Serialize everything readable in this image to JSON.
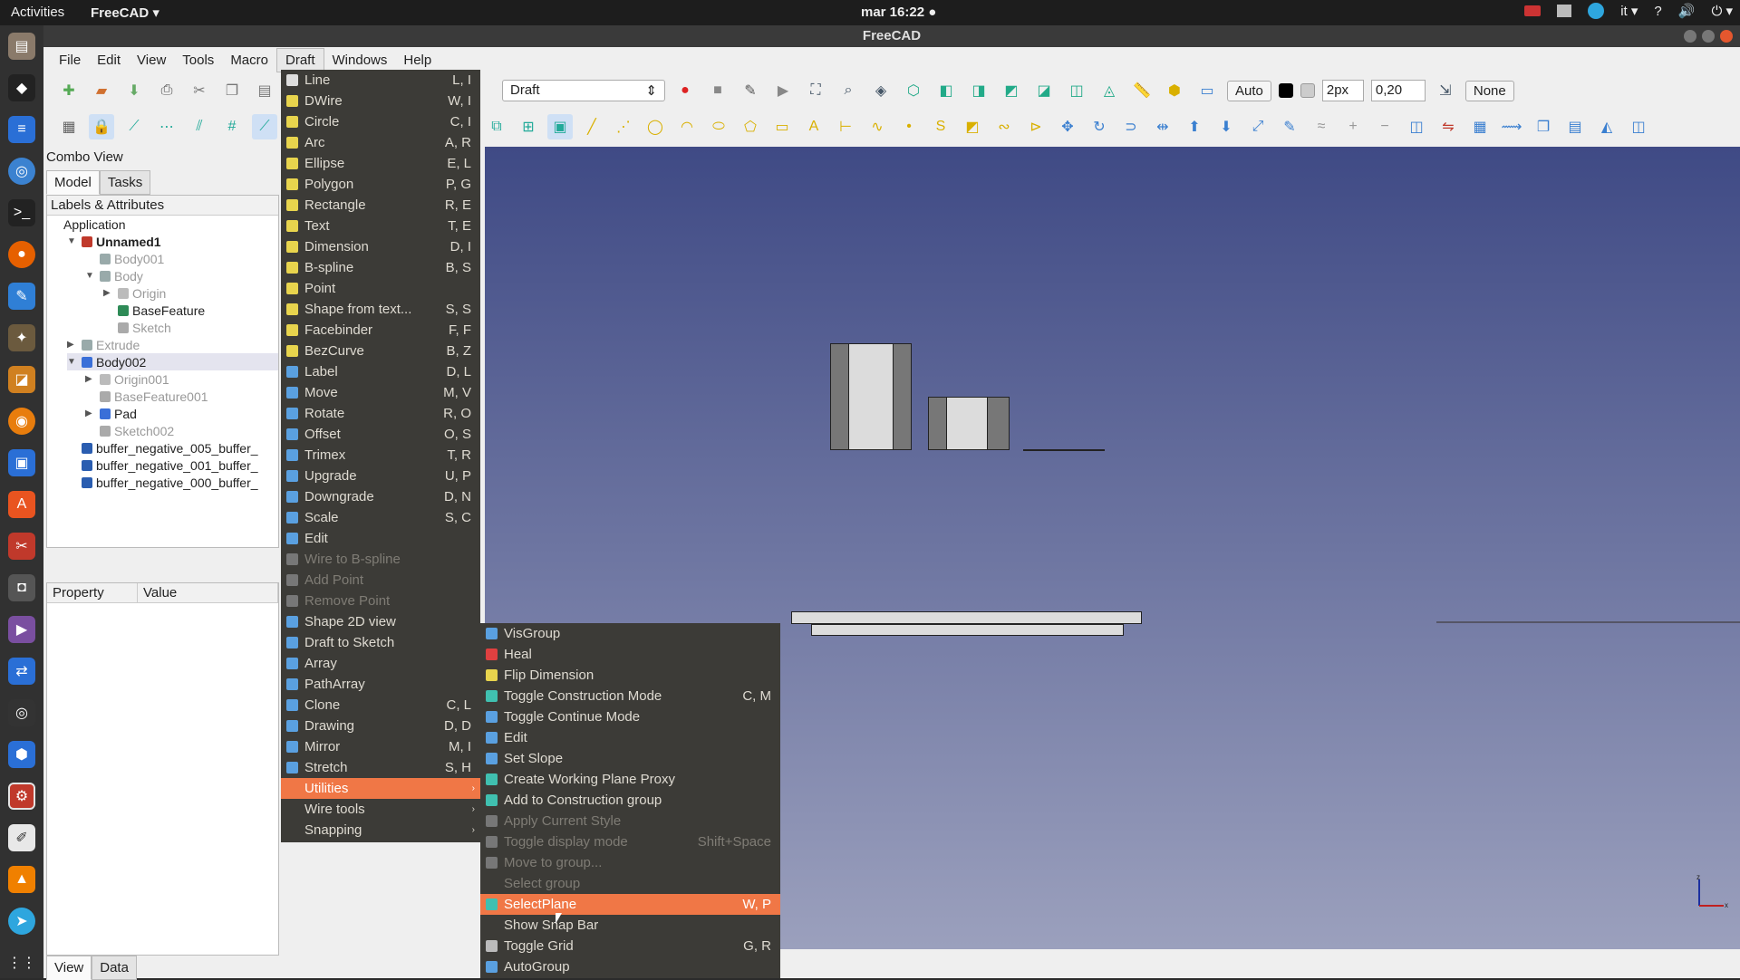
{
  "topbar": {
    "activities": "Activities",
    "app": "FreeCAD ▾",
    "clock": "mar 16:22 ●",
    "lang": "it ▾",
    "help": "?",
    "vol": "🔊",
    "power": "⏻ ▾"
  },
  "window": {
    "title": "FreeCAD"
  },
  "menubar": [
    "File",
    "Edit",
    "View",
    "Tools",
    "Macro",
    "Draft",
    "Windows",
    "Help"
  ],
  "toolbar": {
    "workbench": "Draft",
    "auto": "Auto",
    "linewidth": "2px",
    "fontsize": "0,20",
    "none": "None"
  },
  "combo": {
    "title": "Combo View",
    "tabs": [
      "Model",
      "Tasks"
    ],
    "tree_header": "Labels & Attributes",
    "bottom_tabs": [
      "View",
      "Data"
    ],
    "prop_headers": [
      "Property",
      "Value"
    ]
  },
  "tree": [
    {
      "label": "Application",
      "indent": 0,
      "style": "normal",
      "arrow": "",
      "icon": ""
    },
    {
      "label": "Unnamed1",
      "indent": 1,
      "style": "bold",
      "arrow": "▼",
      "icon": "#c0392b"
    },
    {
      "label": "Body001",
      "indent": 2,
      "style": "dim",
      "arrow": "",
      "icon": "#9aa"
    },
    {
      "label": "Body",
      "indent": 2,
      "style": "dim",
      "arrow": "▼",
      "icon": "#9aa"
    },
    {
      "label": "Origin",
      "indent": 3,
      "style": "dim",
      "arrow": "▶",
      "icon": "#bbb"
    },
    {
      "label": "BaseFeature",
      "indent": 3,
      "style": "normal",
      "arrow": "",
      "icon": "#2e8b57"
    },
    {
      "label": "Sketch",
      "indent": 3,
      "style": "dim",
      "arrow": "",
      "icon": "#aaa"
    },
    {
      "label": "Extrude",
      "indent": 1,
      "style": "dim",
      "arrow": "▶",
      "icon": "#9aa"
    },
    {
      "label": "Body002",
      "indent": 1,
      "style": "sel",
      "arrow": "▼",
      "icon": "#3a6fd8"
    },
    {
      "label": "Origin001",
      "indent": 2,
      "style": "dim",
      "arrow": "▶",
      "icon": "#bbb"
    },
    {
      "label": "BaseFeature001",
      "indent": 2,
      "style": "dim",
      "arrow": "",
      "icon": "#aaa"
    },
    {
      "label": "Pad",
      "indent": 2,
      "style": "normal",
      "arrow": "▶",
      "icon": "#3a6fd8"
    },
    {
      "label": "Sketch002",
      "indent": 2,
      "style": "dim",
      "arrow": "",
      "icon": "#aaa"
    },
    {
      "label": "buffer_negative_005_buffer_",
      "indent": 1,
      "style": "normal",
      "arrow": "",
      "icon": "#2a5db0"
    },
    {
      "label": "buffer_negative_001_buffer_",
      "indent": 1,
      "style": "normal",
      "arrow": "",
      "icon": "#2a5db0"
    },
    {
      "label": "buffer_negative_000_buffer_",
      "indent": 1,
      "style": "normal",
      "arrow": "",
      "icon": "#2a5db0"
    }
  ],
  "draft_menu": [
    {
      "label": "Line",
      "sc": "L, I",
      "ic": "#ddd",
      "st": ""
    },
    {
      "label": "DWire",
      "sc": "W, I",
      "ic": "#e8d44d",
      "st": ""
    },
    {
      "label": "Circle",
      "sc": "C, I",
      "ic": "#e8d44d",
      "st": ""
    },
    {
      "label": "Arc",
      "sc": "A, R",
      "ic": "#e8d44d",
      "st": ""
    },
    {
      "label": "Ellipse",
      "sc": "E, L",
      "ic": "#e8d44d",
      "st": ""
    },
    {
      "label": "Polygon",
      "sc": "P, G",
      "ic": "#e8d44d",
      "st": ""
    },
    {
      "label": "Rectangle",
      "sc": "R, E",
      "ic": "#e8d44d",
      "st": ""
    },
    {
      "label": "Text",
      "sc": "T, E",
      "ic": "#e8d44d",
      "st": ""
    },
    {
      "label": "Dimension",
      "sc": "D, I",
      "ic": "#e8d44d",
      "st": ""
    },
    {
      "label": "B-spline",
      "sc": "B, S",
      "ic": "#e8d44d",
      "st": ""
    },
    {
      "label": "Point",
      "sc": "",
      "ic": "#e8d44d",
      "st": ""
    },
    {
      "label": "Shape from text...",
      "sc": "S, S",
      "ic": "#e8d44d",
      "st": ""
    },
    {
      "label": "Facebinder",
      "sc": "F, F",
      "ic": "#e8d44d",
      "st": ""
    },
    {
      "label": "BezCurve",
      "sc": "B, Z",
      "ic": "#e8d44d",
      "st": ""
    },
    {
      "label": "Label",
      "sc": "D, L",
      "ic": "#5aa0e0",
      "st": ""
    },
    {
      "label": "Move",
      "sc": "M, V",
      "ic": "#5aa0e0",
      "st": ""
    },
    {
      "label": "Rotate",
      "sc": "R, O",
      "ic": "#5aa0e0",
      "st": ""
    },
    {
      "label": "Offset",
      "sc": "O, S",
      "ic": "#5aa0e0",
      "st": ""
    },
    {
      "label": "Trimex",
      "sc": "T, R",
      "ic": "#5aa0e0",
      "st": ""
    },
    {
      "label": "Upgrade",
      "sc": "U, P",
      "ic": "#5aa0e0",
      "st": ""
    },
    {
      "label": "Downgrade",
      "sc": "D, N",
      "ic": "#5aa0e0",
      "st": ""
    },
    {
      "label": "Scale",
      "sc": "S, C",
      "ic": "#5aa0e0",
      "st": ""
    },
    {
      "label": "Edit",
      "sc": "",
      "ic": "#5aa0e0",
      "st": ""
    },
    {
      "label": "Wire to B-spline",
      "sc": "",
      "ic": "#777",
      "st": "dis"
    },
    {
      "label": "Add Point",
      "sc": "",
      "ic": "#777",
      "st": "dis"
    },
    {
      "label": "Remove Point",
      "sc": "",
      "ic": "#777",
      "st": "dis"
    },
    {
      "label": "Shape 2D view",
      "sc": "",
      "ic": "#5aa0e0",
      "st": ""
    },
    {
      "label": "Draft to Sketch",
      "sc": "",
      "ic": "#5aa0e0",
      "st": ""
    },
    {
      "label": "Array",
      "sc": "",
      "ic": "#5aa0e0",
      "st": ""
    },
    {
      "label": "PathArray",
      "sc": "",
      "ic": "#5aa0e0",
      "st": ""
    },
    {
      "label": "Clone",
      "sc": "C, L",
      "ic": "#5aa0e0",
      "st": ""
    },
    {
      "label": "Drawing",
      "sc": "D, D",
      "ic": "#5aa0e0",
      "st": ""
    },
    {
      "label": "Mirror",
      "sc": "M, I",
      "ic": "#5aa0e0",
      "st": ""
    },
    {
      "label": "Stretch",
      "sc": "S, H",
      "ic": "#5aa0e0",
      "st": ""
    },
    {
      "label": "Utilities",
      "sc": "",
      "ic": "",
      "st": "hi",
      "sub": "›"
    },
    {
      "label": "Wire tools",
      "sc": "",
      "ic": "",
      "st": "",
      "sub": "›"
    },
    {
      "label": "Snapping",
      "sc": "",
      "ic": "",
      "st": "",
      "sub": "›"
    }
  ],
  "utilities_menu": [
    {
      "label": "VisGroup",
      "sc": "",
      "ic": "#5aa0e0",
      "st": ""
    },
    {
      "label": "Heal",
      "sc": "",
      "ic": "#e04040",
      "st": ""
    },
    {
      "label": "Flip Dimension",
      "sc": "",
      "ic": "#e8d44d",
      "st": ""
    },
    {
      "label": "Toggle Construction Mode",
      "sc": "C, M",
      "ic": "#40c0b0",
      "st": ""
    },
    {
      "label": "Toggle Continue Mode",
      "sc": "",
      "ic": "#5aa0e0",
      "st": ""
    },
    {
      "label": "Edit",
      "sc": "",
      "ic": "#5aa0e0",
      "st": ""
    },
    {
      "label": "Set Slope",
      "sc": "",
      "ic": "#5aa0e0",
      "st": ""
    },
    {
      "label": "Create Working Plane Proxy",
      "sc": "",
      "ic": "#40c0b0",
      "st": ""
    },
    {
      "label": "Add to Construction group",
      "sc": "",
      "ic": "#40c0b0",
      "st": ""
    },
    {
      "label": "Apply Current Style",
      "sc": "",
      "ic": "#777",
      "st": "dis"
    },
    {
      "label": "Toggle display mode",
      "sc": "Shift+Space",
      "ic": "#777",
      "st": "dis"
    },
    {
      "label": "Move to group...",
      "sc": "",
      "ic": "#777",
      "st": "dis"
    },
    {
      "label": "Select group",
      "sc": "",
      "ic": "",
      "st": "dis"
    },
    {
      "label": "SelectPlane",
      "sc": "W, P",
      "ic": "#40c0b0",
      "st": "hi"
    },
    {
      "label": "Show Snap Bar",
      "sc": "",
      "ic": "",
      "st": ""
    },
    {
      "label": "Toggle Grid",
      "sc": "G, R",
      "ic": "#bbb",
      "st": ""
    },
    {
      "label": "AutoGroup",
      "sc": "",
      "ic": "#5aa0e0",
      "st": ""
    }
  ],
  "colors": {
    "menu_bg": "#3c3b37",
    "highlight": "#f07746",
    "view_top": "#3f4a85",
    "view_bottom": "#9ba0bd"
  }
}
